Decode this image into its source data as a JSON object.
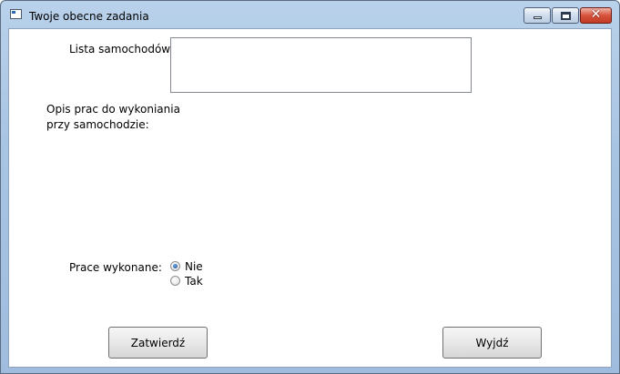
{
  "window": {
    "title": "Twoje obecne zadania",
    "controls": {
      "minimize": "_",
      "maximize": "□",
      "close": "✕"
    }
  },
  "form": {
    "cars_label": "Lista samochodów:",
    "description_label_line1": "Opis prac do wykoniania",
    "description_label_line2": "przy samochodzie:",
    "works_done_label": "Prace wykonane:",
    "radio_options": [
      {
        "label": "Nie",
        "checked": true
      },
      {
        "label": "Tak",
        "checked": false
      }
    ]
  },
  "buttons": {
    "confirm": "Zatwierdź",
    "exit": "Wyjdź"
  }
}
